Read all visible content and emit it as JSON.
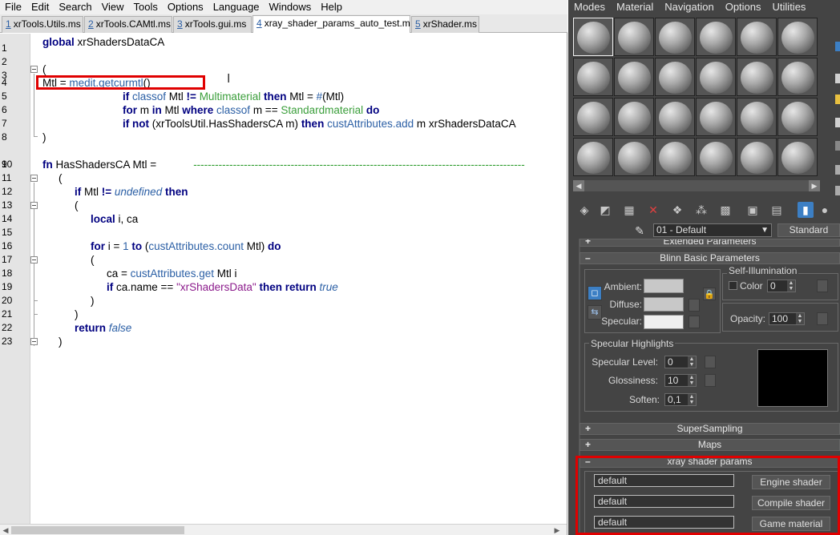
{
  "editor": {
    "menu": [
      "File",
      "Edit",
      "Search",
      "View",
      "Tools",
      "Options",
      "Language",
      "Windows",
      "Help"
    ],
    "tabs": [
      {
        "num": "1",
        "label": "xrTools.Utils.ms",
        "active": false
      },
      {
        "num": "2",
        "label": "xrTools.CAMtl.ms",
        "active": false
      },
      {
        "num": "3",
        "label": "xrTools.gui.ms",
        "active": false
      },
      {
        "num": "4",
        "label": "xray_shader_params_auto_test.ms",
        "active": true
      },
      {
        "num": "5",
        "label": "xrShader.ms",
        "active": false
      }
    ],
    "line_numbers": [
      "1",
      "2",
      "3",
      "4",
      "5",
      "6",
      "7",
      "8",
      "9",
      "10",
      "11",
      "12",
      "13",
      "14",
      "15",
      "16",
      "17",
      "18",
      "19",
      "20",
      "21",
      "22",
      "23"
    ],
    "code": {
      "l1": {
        "kw": "global",
        "rest": " xrShadersDataCA"
      },
      "l3": {
        "text": "("
      },
      "l4": {
        "a": "Mtl = ",
        "fn": "medit.getcurmtl",
        "b": "()"
      },
      "l5": {
        "kw1": "if",
        "fn1": "classof",
        "t1": " Mtl ",
        "kw2": "!=",
        "cls": " Multimaterial",
        "kw3": " then",
        "t2": " Mtl = ",
        "fn2": "#",
        "t3": "(Mtl)"
      },
      "l6": {
        "kw1": "for",
        "t1": " m ",
        "kw2": "in",
        "t2": " Mtl ",
        "kw3": "where",
        "fn1": " classof",
        "t3": " m == ",
        "cls": "Standardmaterial",
        "kw4": " do"
      },
      "l7": {
        "kw1": "if not",
        "t1": " (xrToolsUtil.HasShadersCA m) ",
        "kw2": "then",
        "fn1": " custAttributes.add",
        "t2": " m xrShadersDataCA"
      },
      "l8": {
        "text": ")"
      },
      "l10": {
        "kw": "fn",
        "t": " HasShadersCA Mtl =",
        "dash": "--------------------------------------------------------------------------------------------"
      },
      "l11": {
        "text": "("
      },
      "l12": {
        "kw1": "if",
        "t1": " Mtl ",
        "kw2": "!=",
        "lit": " undefined",
        "kw3": " then"
      },
      "l13": {
        "text": "("
      },
      "l14": {
        "kw": "local",
        "t": " i, ca"
      },
      "l16": {
        "kw1": "for",
        "t1": " i = ",
        "n1": "1",
        "kw2": " to",
        "t2": " (",
        "fn1": "custAttributes.count",
        "t3": " Mtl) ",
        "kw3": "do"
      },
      "l17": {
        "text": "("
      },
      "l18": {
        "t1": "ca = ",
        "fn1": "custAttributes.get",
        "t2": " Mtl i"
      },
      "l19": {
        "kw1": "if",
        "t1": " ca.name == ",
        "str": "\"xrShadersData\"",
        "kw2": " then return",
        "lit": " true"
      },
      "l20": {
        "text": ")"
      },
      "l21": {
        "text": ")"
      },
      "l22": {
        "kw": "return",
        "lit": " false"
      },
      "l23": {
        "text": ")"
      }
    }
  },
  "material_editor": {
    "menu": [
      "Modes",
      "Material",
      "Navigation",
      "Options",
      "Utilities"
    ],
    "material_name": "01 - Default",
    "material_type": "Standard",
    "rollouts": {
      "extended": "Extended Parameters",
      "blinn": "Blinn Basic Parameters",
      "supersampling": "SuperSampling",
      "maps": "Maps",
      "xray": "xray shader params"
    },
    "blinn": {
      "ambient_label": "Ambient:",
      "diffuse_label": "Diffuse:",
      "specular_label": "Specular:",
      "self_illum_title": "Self-Illumination",
      "color_label": "Color",
      "color_value": "0",
      "opacity_label": "Opacity:",
      "opacity_value": "100",
      "spec_highlights_title": "Specular Highlights",
      "spec_level_label": "Specular Level:",
      "spec_level_value": "0",
      "glossiness_label": "Glossiness:",
      "glossiness_value": "10",
      "soften_label": "Soften:",
      "soften_value": "0,1"
    },
    "xray": {
      "field1": "default",
      "field2": "default",
      "field3": "default",
      "btn_engine": "Engine shader",
      "btn_compile": "Compile shader",
      "btn_game": "Game material"
    },
    "colors": {
      "ambient": "#c8c8c8",
      "diffuse": "#c8c8c8",
      "specular": "#f0f0f0",
      "highlight_box": "#e00000"
    }
  }
}
